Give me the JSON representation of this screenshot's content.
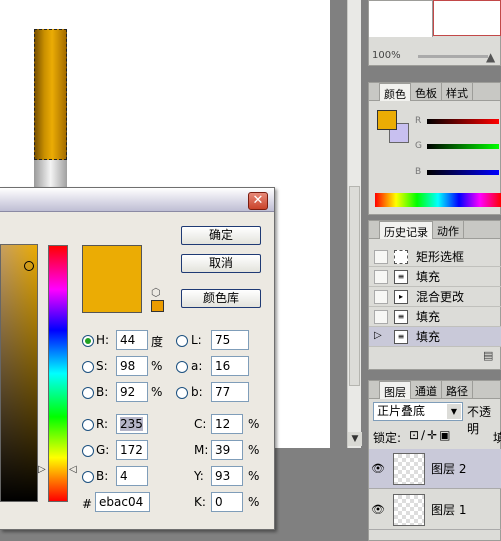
{
  "navigator": {
    "zoom": "100%"
  },
  "color_panel": {
    "tabs": [
      "颜色",
      "色板",
      "样式"
    ],
    "r_label": "R",
    "g_label": "G",
    "b_label": "B",
    "fg_color": "#ebac04",
    "bg_color": "#c8c0f0"
  },
  "history_panel": {
    "tabs": [
      "历史记录",
      "动作"
    ],
    "items": [
      "矩形选框",
      "填充",
      "混合更改",
      "填充",
      "填充"
    ]
  },
  "layers_panel": {
    "tabs": [
      "图层",
      "通道",
      "路径"
    ],
    "blend_mode": "正片叠底",
    "opacity_label": "不透明",
    "lock_label": "锁定:",
    "fill_label": "填",
    "layers": [
      "图层 2",
      "图层 1"
    ]
  },
  "picker": {
    "ok": "确定",
    "cancel": "取消",
    "library": "颜色库",
    "h_label": "H:",
    "h": "44",
    "h_unit": "度",
    "s_label": "S:",
    "s": "98",
    "s_unit": "%",
    "b_label": "B:",
    "b": "92",
    "b_unit": "%",
    "r_label": "R:",
    "r": "235",
    "g_label": "G:",
    "g": "172",
    "bb_label": "B:",
    "bb": "4",
    "l_label": "L:",
    "l": "75",
    "a_label": "a:",
    "a": "16",
    "lb_label": "b:",
    "lb": "77",
    "c_label": "C:",
    "c": "12",
    "m_label": "M:",
    "m": "39",
    "y_label": "Y:",
    "y": "93",
    "k_label": "K:",
    "k": "0",
    "pct": "%",
    "hex_label": "#",
    "hex": "ebac04",
    "close_glyph": "✕"
  }
}
